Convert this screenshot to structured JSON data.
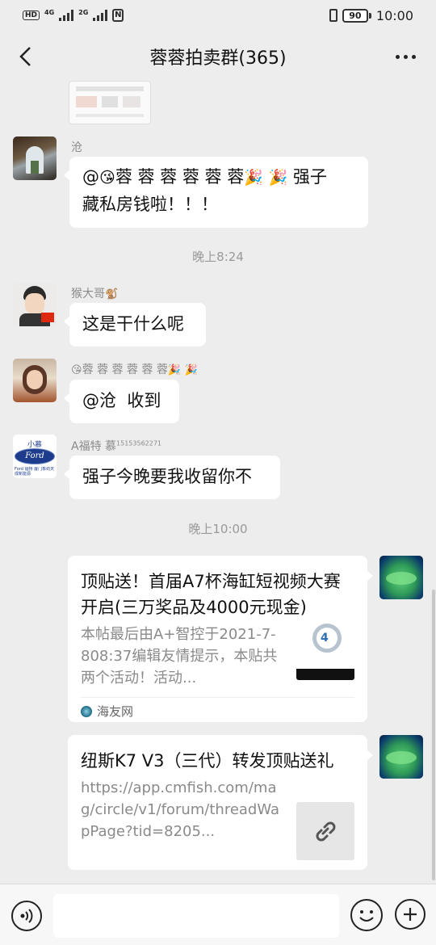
{
  "status_bar": {
    "network_left": "HD",
    "sim1_type": "4G",
    "sim2_type": "2G",
    "battery": "90",
    "time": "10:00"
  },
  "header": {
    "title": "蓉蓉拍卖群(365)"
  },
  "messages": [
    {
      "sender": "沧",
      "text_prefix": "@",
      "text_name": "蓉 蓉 蓉 蓉 蓉 蓉",
      "text_line1_tail": " 强子",
      "text_line2": "藏私房钱啦！！！"
    },
    {
      "timestamp": "晚上8:24"
    },
    {
      "sender": "猴大哥",
      "text": "这是干什么呢"
    },
    {
      "sender": "蓉 蓉 蓉 蓉 蓉 蓉",
      "text": "@沧  收到"
    },
    {
      "sender": "A福特 慕",
      "sender_sup": "15153562271",
      "text": "强子今晚要我收留你不"
    },
    {
      "timestamp": "晚上10:00"
    },
    {
      "card_title": "顶贴送！首届A7杯海缸短视频大赛开启(三万奖品及4000元现金)",
      "card_desc": "本帖最后由A+智控于2021-7-808:37编辑友情提示，本贴共两个活动！活动...",
      "card_source": "海友网"
    },
    {
      "card_title": "纽斯K7 V3（三代）转发顶贴送礼",
      "card_desc": "https://app.cmfish.com/mag/circle/v1/forum/threadWapPage?tid=8205..."
    }
  ],
  "avatars": {
    "ford_top": "小慕",
    "ford_logo": "Ford",
    "ford_sub": "Ford 福特 厦门象屿天成新能源"
  },
  "input": {
    "placeholder": ""
  },
  "colors": {
    "background": "#ededed",
    "bubble": "#ffffff",
    "meta_text": "#999999"
  }
}
